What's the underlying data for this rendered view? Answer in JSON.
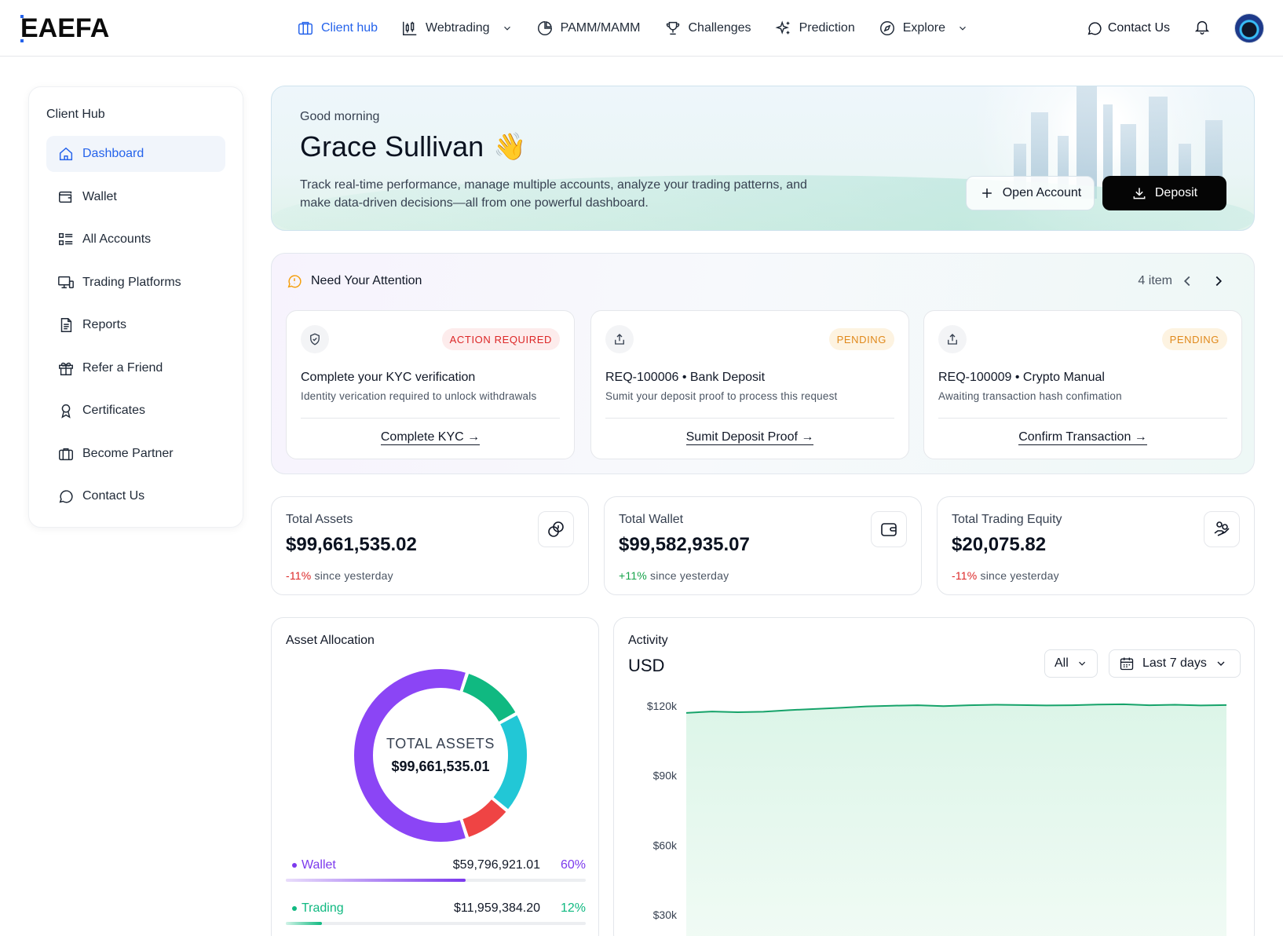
{
  "brand": {
    "logo_text": "EAEFA",
    "accent": "#2563eb"
  },
  "nav": {
    "links": [
      {
        "label": "Client hub",
        "icon": "building-icon",
        "active": true
      },
      {
        "label": "Webtrading",
        "icon": "candlestick-icon",
        "dropdown": true
      },
      {
        "label": "PAMM/MAMM",
        "icon": "pie-icon"
      },
      {
        "label": "Challenges",
        "icon": "trophy-icon"
      },
      {
        "label": "Prediction",
        "icon": "sparkle-icon"
      },
      {
        "label": "Explore",
        "icon": "compass-icon",
        "dropdown": true
      }
    ],
    "contact_label": "Contact Us"
  },
  "sidebar": {
    "title": "Client Hub",
    "items": [
      {
        "label": "Dashboard",
        "icon": "home-icon",
        "active": true
      },
      {
        "label": "Wallet",
        "icon": "wallet-icon"
      },
      {
        "label": "All Accounts",
        "icon": "list-icon"
      },
      {
        "label": "Trading Platforms",
        "icon": "devices-icon"
      },
      {
        "label": "Reports",
        "icon": "document-icon"
      },
      {
        "label": "Refer a Friend",
        "icon": "gift-icon"
      },
      {
        "label": "Certificates",
        "icon": "award-icon"
      },
      {
        "label": "Become Partner",
        "icon": "briefcase-icon"
      },
      {
        "label": "Contact Us",
        "icon": "chat-icon"
      }
    ]
  },
  "hero": {
    "greeting": "Good morning",
    "name": "Grace Sullivan",
    "emoji": "👋",
    "description": "Track real-time performance, manage multiple accounts, analyze your trading patterns, and make data-driven decisions—all from one powerful dashboard.",
    "open_account_label": "Open Account",
    "deposit_label": "Deposit"
  },
  "attention": {
    "title": "Need Your Attention",
    "count": "4 item",
    "cards": [
      {
        "badge": "ACTION REQUIRED",
        "badge_color": "#dc2626",
        "title": "Complete your KYC verification",
        "subtitle": "Identity verication required to unlock withdrawals",
        "link": "Complete KYC →",
        "icon": "shield-check-icon"
      },
      {
        "badge": "PENDING",
        "badge_color": "#e0891b",
        "title": "REQ-100006 • Bank Deposit",
        "subtitle": "Sumit your deposit proof to process this request",
        "link": "Sumit Deposit Proof →",
        "icon": "upload-icon"
      },
      {
        "badge": "PENDING",
        "badge_color": "#e0891b",
        "title": "REQ-100009 • Crypto Manual",
        "subtitle": "Awaiting transaction hash confimation",
        "link": "Confirm Transaction →",
        "icon": "upload-icon"
      }
    ]
  },
  "stats": [
    {
      "label": "Total Assets",
      "value": "$99,661,535.02",
      "change": "-11%",
      "direction": "down",
      "suffix": " since yesterday",
      "icon": "coins-icon"
    },
    {
      "label": "Total Wallet",
      "value": "$99,582,935.07",
      "change": "+11%",
      "direction": "up",
      "suffix": " since yesterday",
      "icon": "wallet-icon"
    },
    {
      "label": "Total Trading Equity",
      "value": "$20,075.82",
      "change": "-11%",
      "direction": "down",
      "suffix": " since yesterday",
      "icon": "hand-coins-icon"
    }
  ],
  "allocation": {
    "title": "Asset Allocation",
    "center_label": "TOTAL ASSETS",
    "center_value": "$99,661,535.01",
    "rows": [
      {
        "name": "Wallet",
        "amount": "$59,796,921.01",
        "pct_label": "60%",
        "pct": 0.6,
        "color": "#7c3aed"
      },
      {
        "name": "Trading",
        "amount": "$11,959,384.20",
        "pct_label": "12%",
        "pct": 0.12,
        "color": "#10b981"
      }
    ]
  },
  "chart_data": {
    "type": "pie",
    "title": "Asset Allocation",
    "slices": [
      {
        "name": "Wallet",
        "value": 60,
        "color": "#8b45f5"
      },
      {
        "name": "Trading",
        "value": 12,
        "color": "#10b981"
      },
      {
        "name": "",
        "value": 19,
        "color": "#22c7d6"
      },
      {
        "name": "",
        "value": 9,
        "color": "#ef4444"
      }
    ]
  },
  "activity": {
    "title": "Activity",
    "currency": "USD",
    "filter_label": "All",
    "range_label": "Last 7 days",
    "chart_data": {
      "type": "area",
      "ylim": [
        0,
        125000
      ],
      "yticks": [
        30000,
        60000,
        90000,
        120000
      ],
      "ytick_labels": [
        "$30k",
        "$60k",
        "$90k",
        "$120k"
      ],
      "values": [
        117000,
        117600,
        117300,
        117500,
        118200,
        118700,
        119200,
        119800,
        120100,
        120300,
        119900,
        120300,
        120500,
        120400,
        120200,
        120300,
        120600,
        120700,
        120300,
        120500,
        120200,
        120400
      ]
    }
  }
}
